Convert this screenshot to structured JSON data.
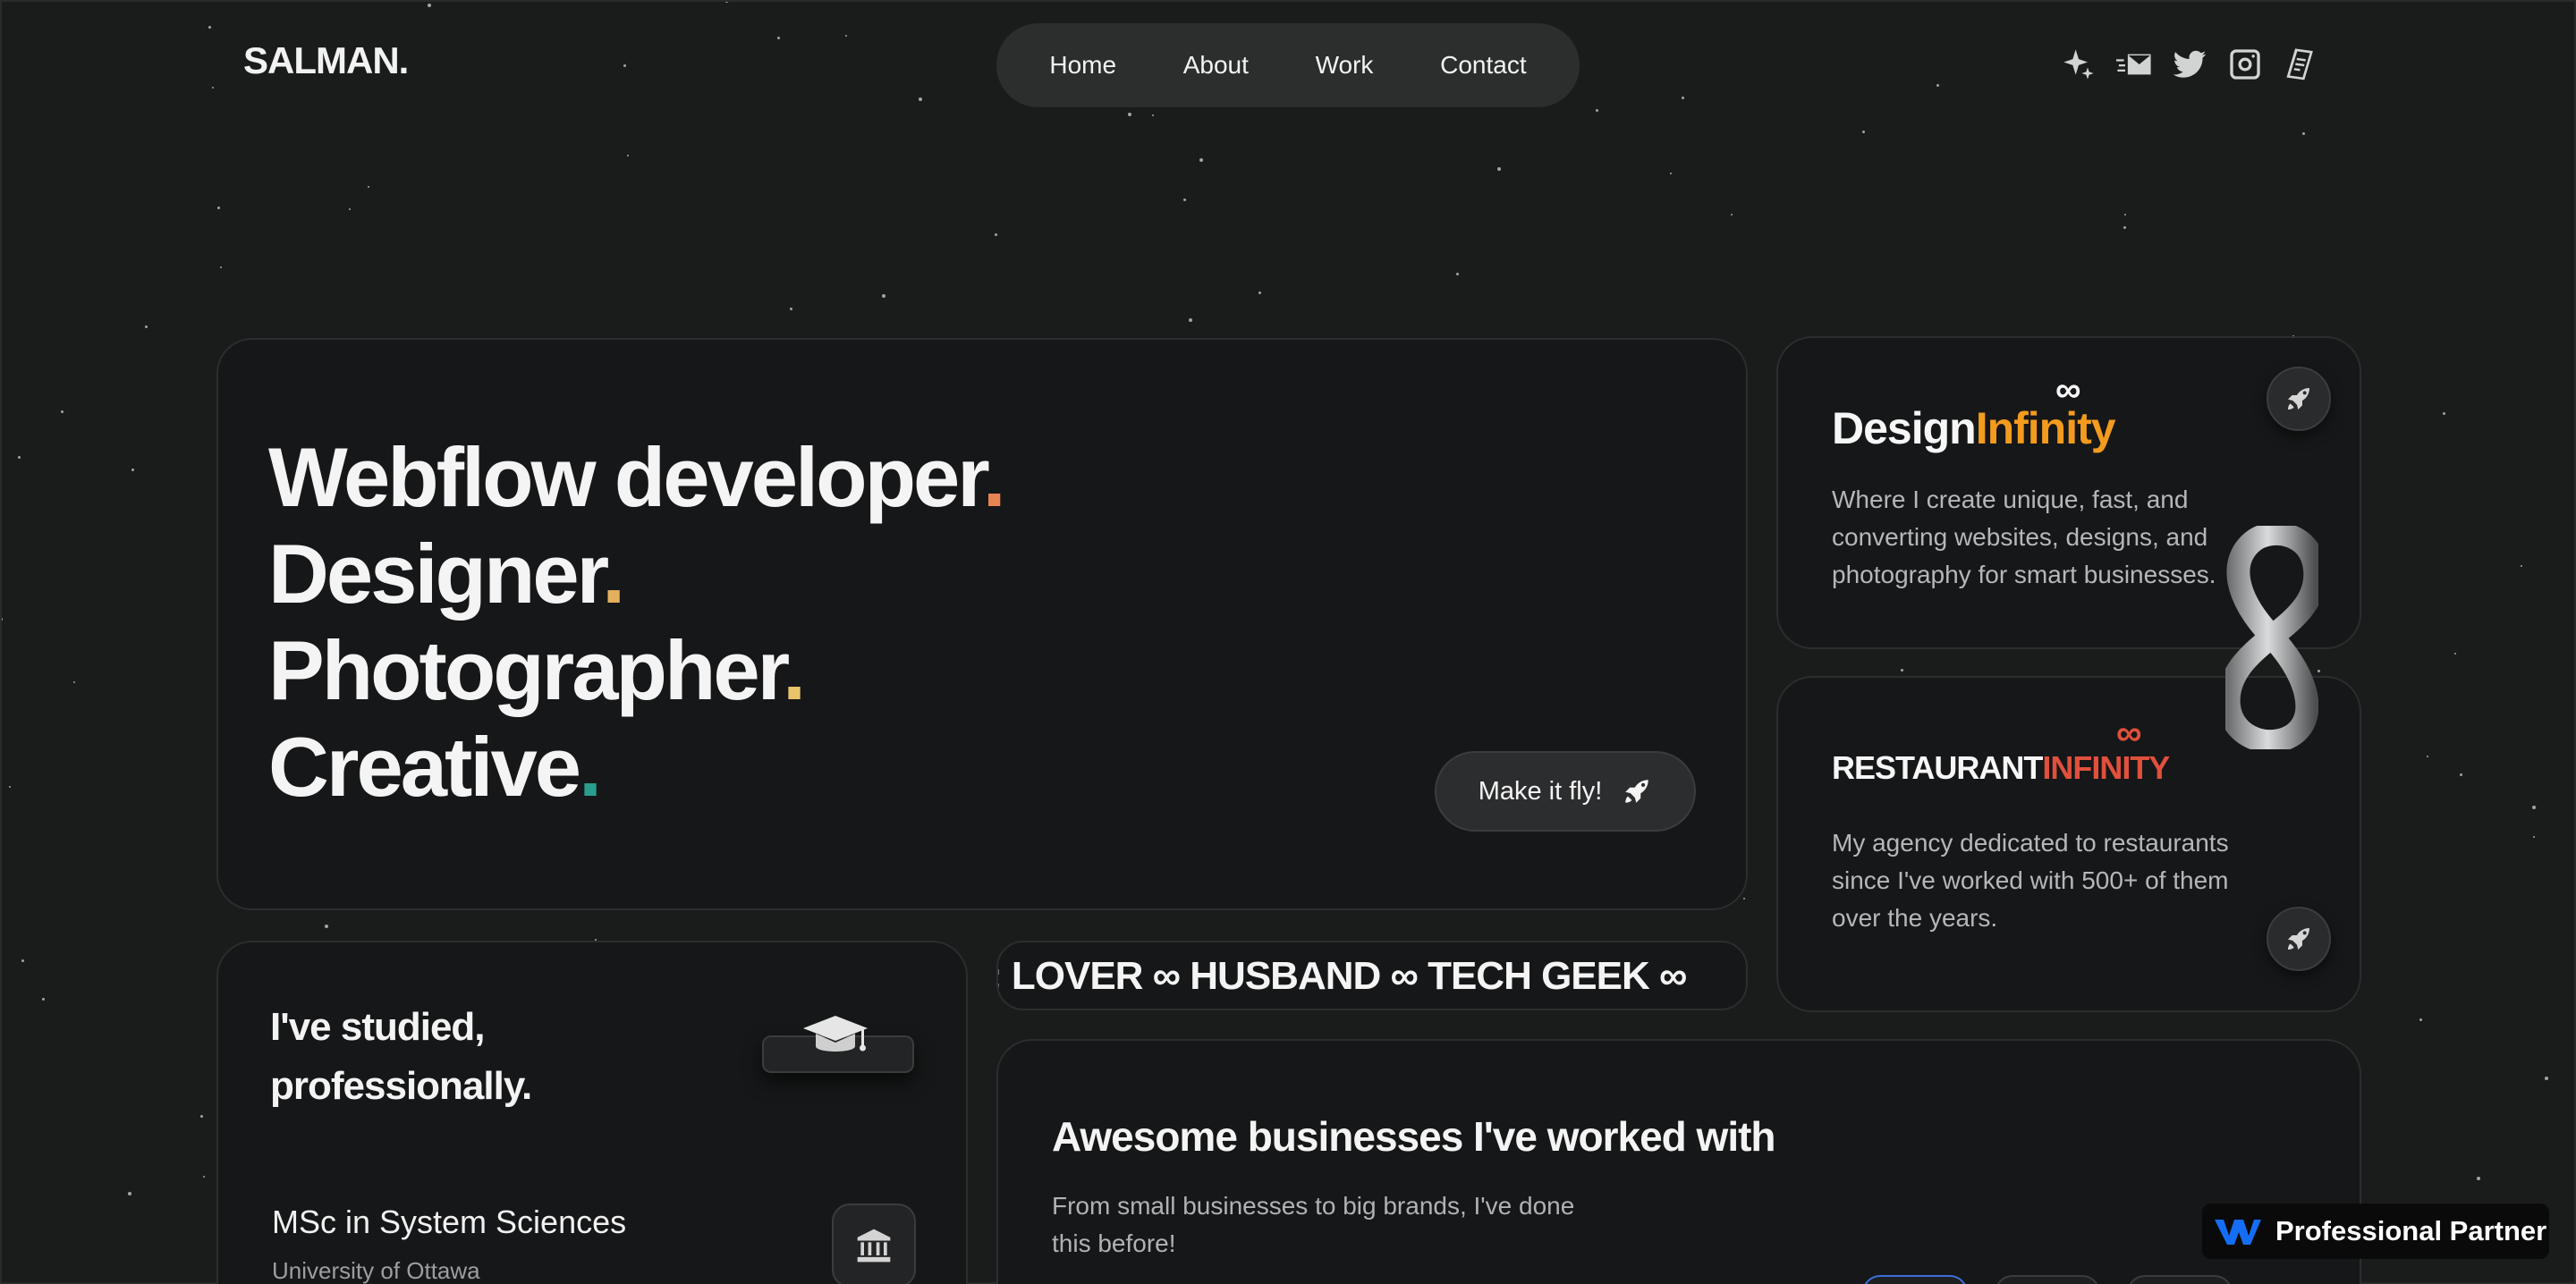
{
  "header": {
    "logo": "SALMAN.",
    "nav": [
      "Home",
      "About",
      "Work",
      "Contact"
    ],
    "social_icons": [
      "sparkle-icon",
      "email-icon",
      "twitter-icon",
      "instagram-icon",
      "resume-icon"
    ]
  },
  "hero": {
    "lines": [
      {
        "text": "Webflow developer",
        "dot": ".",
        "dot_color": "#e88353"
      },
      {
        "text": "Designer",
        "dot": ".",
        "dot_color": "#e3b05d"
      },
      {
        "text": "Photographer",
        "dot": ".",
        "dot_color": "#e9c46a"
      },
      {
        "text": "Creative",
        "dot": ".",
        "dot_color": "#2a9d8f"
      }
    ],
    "cta": "Make it fly!"
  },
  "design_infinity": {
    "brand_part1": "Design",
    "brand_part2": "Infinity",
    "description": "Where I create unique, fast, and converting websites, designs, and photography for smart businesses."
  },
  "restaurant_infinity": {
    "brand_part1": "RESTAURANT",
    "brand_part2": "INFINITY",
    "description": "My agency dedicated to restaurants since I've worked with 500+ of them over the years."
  },
  "education": {
    "title_line1": "I've studied,",
    "title_line2": "professionally.",
    "degree": "MSc in System Sciences",
    "school": "University of Ottawa"
  },
  "marquee": {
    "text": ": LOVER ∞ HUSBAND ∞ TECH GEEK ∞"
  },
  "businesses": {
    "title": "Awesome businesses I've worked with",
    "subtitle": "From small businesses to big brands, I've done this before!"
  },
  "webflow_badge": {
    "label": "Professional Partner"
  },
  "colors": {
    "background": "#1a1c1c",
    "card": "#161718",
    "accent_orange": "#f29b1e",
    "accent_red": "#e0503c",
    "webflow_blue": "#146ef5"
  }
}
